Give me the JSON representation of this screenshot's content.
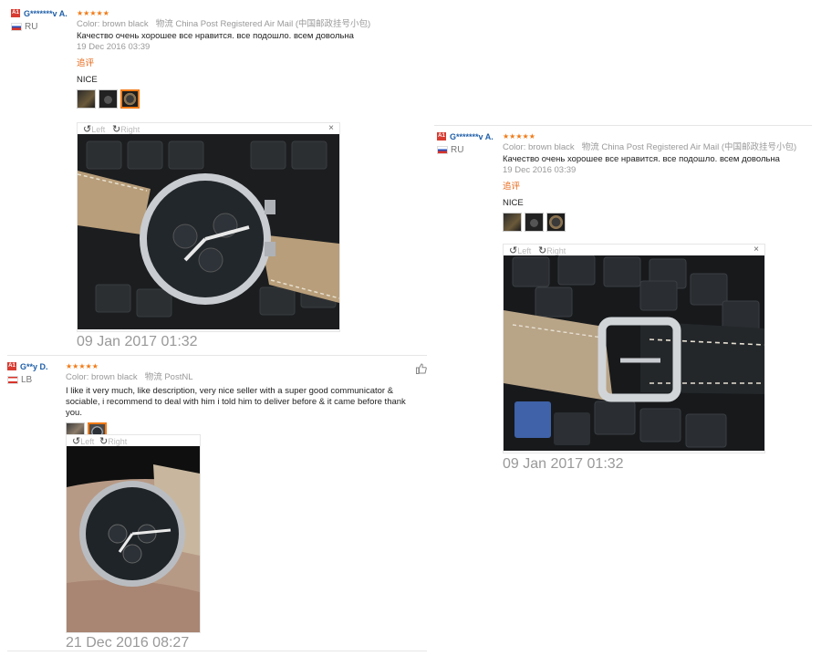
{
  "reviews": [
    {
      "level_badge": "A1",
      "user": "G*******v A.",
      "country": "RU",
      "stars": "★★★★★",
      "color_label": "Color:",
      "color_value": "brown black",
      "shipping_label": "物流",
      "shipping_value": "China Post Registered Air Mail (中国邮政挂号小包)",
      "text": "Качество очень хорошее все нравится. все подошло. всем довольна",
      "date": "19 Dec 2016 03:39",
      "additional_label": "追评",
      "additional_text": "NICE",
      "viewer": {
        "left": "Left",
        "right": "Right",
        "close": "×"
      },
      "additional_date": "09 Jan 2017 01:32"
    },
    {
      "level_badge": "A1",
      "user": "G**y D.",
      "country": "LB",
      "stars": "★★★★★",
      "color_label": "Color:",
      "color_value": "brown black",
      "shipping_label": "物流",
      "shipping_value": "PostNL",
      "text": "I like it very much, like description, very nice seller with a super good communicator & sociable, i recommend to deal with him i told him to deliver before & it came before thank you.",
      "viewer": {
        "left": "Left",
        "right": "Right",
        "close": "×"
      },
      "date": "21 Dec 2016 08:27"
    },
    {
      "level_badge": "A1",
      "user": "G*******v A.",
      "country": "RU",
      "stars": "★★★★★",
      "color_label": "Color:",
      "color_value": "brown black",
      "shipping_label": "物流",
      "shipping_value": "China Post Registered Air Mail (中国邮政挂号小包)",
      "text": "Качество очень хорошее все нравится. все подошло. всем довольна",
      "date": "19 Dec 2016 03:39",
      "additional_label": "追评",
      "additional_text": "NICE",
      "viewer": {
        "left": "Left",
        "right": "Right",
        "close": "×"
      },
      "additional_date": "09 Jan 2017 01:32"
    }
  ],
  "icons": {
    "rotate_left": "rotate-left-icon",
    "rotate_right": "rotate-right-icon",
    "thumbs_up": "thumbs-up-icon",
    "close": "close-icon"
  },
  "colors": {
    "stars": "#f17b17",
    "username": "#1f5fa8",
    "followup": "#e56a1b",
    "active_thumb": "#f17b17"
  }
}
